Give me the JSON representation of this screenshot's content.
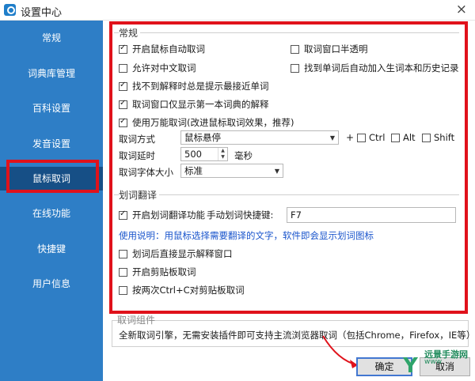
{
  "window": {
    "title": "设置中心",
    "close_glyph": "×"
  },
  "sidebar": {
    "items": [
      {
        "label": "常规"
      },
      {
        "label": "词典库管理"
      },
      {
        "label": "百科设置"
      },
      {
        "label": "发音设置"
      },
      {
        "label": "鼠标取词",
        "active": true
      },
      {
        "label": "在线功能"
      },
      {
        "label": "快捷键"
      },
      {
        "label": "用户信息"
      }
    ]
  },
  "general": {
    "title": "常规",
    "options": [
      {
        "label": "开启鼠标自动取词",
        "checked": true
      },
      {
        "label": "取词窗口半透明",
        "checked": false
      },
      {
        "label": "允许对中文取词",
        "checked": false
      },
      {
        "label": "找到单词后自动加入生词本和历史记录",
        "checked": false
      },
      {
        "label": "找不到解释时总是提示最接近单词",
        "checked": true
      },
      {
        "label": "取词窗口仅显示第一本词典的解释",
        "checked": true
      },
      {
        "label": "使用万能取词(改进鼠标取词效果，推荐)",
        "checked": true
      }
    ],
    "method": {
      "label": "取词方式",
      "value": "鼠标悬停",
      "plus": "+",
      "modifiers": [
        {
          "label": "Ctrl",
          "checked": false
        },
        {
          "label": "Alt",
          "checked": false
        },
        {
          "label": "Shift",
          "checked": false
        }
      ]
    },
    "delay": {
      "label": "取词延时",
      "value": "500",
      "unit": "毫秒"
    },
    "font_size": {
      "label": "取词字体大小",
      "value": "标准"
    }
  },
  "translate": {
    "title": "划词翻译",
    "enable": {
      "label": "开启划词翻译功能",
      "checked": true
    },
    "hotkey": {
      "label": "手动划词快捷键:",
      "value": "F7"
    },
    "usage": "使用说明：用鼠标选择需要翻译的文字，软件即会显示划词图标",
    "options": [
      {
        "label": "划词后直接显示解释窗口",
        "checked": false
      },
      {
        "label": "开启剪贴板取词",
        "checked": false
      },
      {
        "label": "按两次Ctrl+C对剪贴板取词",
        "checked": false
      }
    ]
  },
  "engine": {
    "title": "取词组件",
    "description": "全新取词引擎，无需安装插件即可支持主流浏览器取词（包括Chrome，Firefox，IE等）"
  },
  "footer": {
    "ok_label": "确定",
    "cancel_label": "取消"
  },
  "watermark": {
    "text": "远景手游网",
    "sub": "www"
  },
  "colors": {
    "sidebar": "#2e7ec6",
    "sidebar_active": "#164f86",
    "highlight": "#e0121b",
    "link": "#1a55cc"
  }
}
